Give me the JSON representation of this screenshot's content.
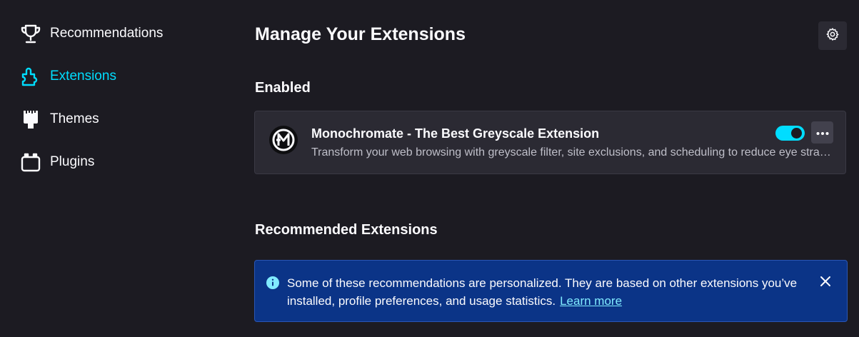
{
  "sidebar": {
    "items": [
      {
        "label": "Recommendations",
        "icon": "trophy-icon",
        "active": false
      },
      {
        "label": "Extensions",
        "icon": "puzzle-icon",
        "active": true
      },
      {
        "label": "Themes",
        "icon": "paintbrush-icon",
        "active": false
      },
      {
        "label": "Plugins",
        "icon": "plugin-icon",
        "active": false
      }
    ]
  },
  "main": {
    "title": "Manage Your Extensions",
    "settings_icon": "gear-icon",
    "enabled_heading": "Enabled",
    "extension": {
      "name": "Monochromate - The Best Greyscale Extension",
      "description": "Transform your web browsing with greyscale filter, site exclusions, and scheduling to reduce eye strain and improve focus.",
      "enabled": true,
      "more_icon": "ellipsis-icon"
    },
    "recommended_heading": "Recommended Extensions",
    "notice": {
      "text": "Some of these recommendations are personalized. They are based on other extensions you’ve installed, profile preferences, and usage statistics.",
      "link_label": "Learn more",
      "close_icon": "close-icon"
    }
  },
  "colors": {
    "background": "#1c1b22",
    "card": "#2b2a33",
    "accent": "#00ddff",
    "notice_bg": "#0b3487"
  }
}
